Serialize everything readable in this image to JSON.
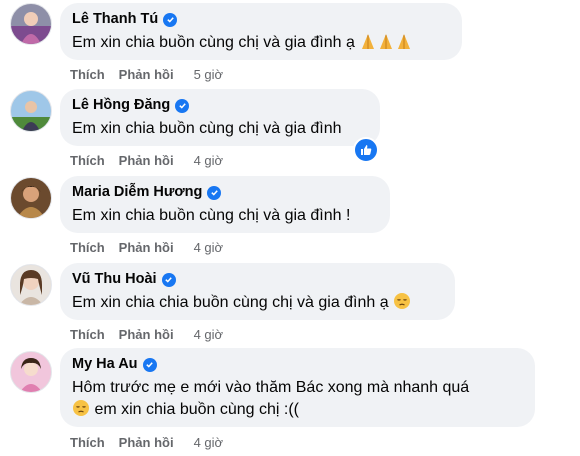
{
  "comments": [
    {
      "author": "Lê Thanh Tú",
      "text": "Em xin chia buồn cùng chị và gia đình ạ",
      "emoji": [
        "folded-hands",
        "folded-hands",
        "folded-hands"
      ],
      "like_label": "Thích",
      "reply_label": "Phản hồi",
      "time": "5 giờ"
    },
    {
      "author": "Lê Hồng Đăng",
      "text": "Em xin chia buồn cùng chị và gia đình",
      "reaction": "like",
      "like_label": "Thích",
      "reply_label": "Phản hồi",
      "time": "4 giờ"
    },
    {
      "author": "Maria Diễm Hương",
      "text": "Em xin chia buồn cùng chị và gia đình !",
      "like_label": "Thích",
      "reply_label": "Phản hồi",
      "time": "4 giờ"
    },
    {
      "author": "Vũ Thu Hoài",
      "text": "Em xin chia chia buồn cùng chị và gia đình ạ",
      "emoji": [
        "pensive-face"
      ],
      "like_label": "Thích",
      "reply_label": "Phản hồi",
      "time": "4 giờ"
    },
    {
      "author": "My Ha Au",
      "text_line1": "Hôm trước mẹ e mới vào thăm Bác xong mà nhanh quá",
      "text_line2": "em xin chia buồn cùng chị :((",
      "emoji": [
        "pensive-face"
      ],
      "like_label": "Thích",
      "reply_label": "Phản hồi",
      "time": "4 giờ"
    }
  ],
  "colors": {
    "bubble": "#f0f2f5",
    "meta": "#65676b",
    "verified": "#1877f2"
  }
}
